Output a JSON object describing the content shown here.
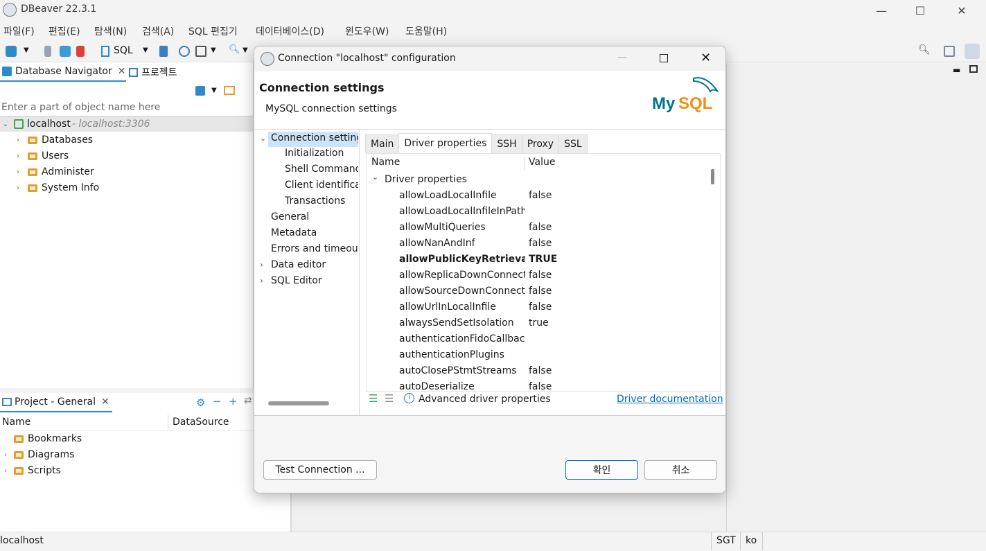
{
  "app": {
    "title": "DBeaver 22.3.1"
  },
  "menu": [
    "파일(F)",
    "편집(E)",
    "탐색(N)",
    "검색(A)",
    "SQL 편집기",
    "데이터베이스(D)",
    "윈도우(W)",
    "도움말(H)"
  ],
  "toolbar": {
    "sql_label": "SQL"
  },
  "navigator": {
    "tab_label": "Database Navigator",
    "tab2_label": "프로젝트",
    "filter_placeholder": "Enter a part of object name here",
    "connection": {
      "name": "localhost",
      "host": " - localhost:3306"
    },
    "items": [
      "Databases",
      "Users",
      "Administer",
      "System Info"
    ]
  },
  "project": {
    "tab_label": "Project - General",
    "col_name": "Name",
    "col_datasource": "DataSource",
    "items": [
      "Bookmarks",
      "Diagrams",
      "Scripts"
    ]
  },
  "status": {
    "left": "localhost",
    "tz": "SGT",
    "locale": "ko"
  },
  "dialog": {
    "title": "Connection \"localhost\" configuration",
    "heading": "Connection settings",
    "subheading": "MySQL connection settings",
    "logo_text": "MySQL",
    "nav": {
      "main": "Connection settings",
      "children": [
        "Initialization",
        "Shell Commands",
        "Client identification",
        "Transactions"
      ],
      "others": [
        "General",
        "Metadata",
        "Errors and timeouts"
      ],
      "expandable": [
        "Data editor",
        "SQL Editor"
      ]
    },
    "tabs": [
      "Main",
      "Driver properties",
      "SSH",
      "Proxy",
      "SSL"
    ],
    "grid": {
      "col_name": "Name",
      "col_value": "Value",
      "group": "Driver properties",
      "rows": [
        {
          "name": "allowLoadLocalInfile",
          "value": "false"
        },
        {
          "name": "allowLoadLocalInfileInPath",
          "value": ""
        },
        {
          "name": "allowMultiQueries",
          "value": "false"
        },
        {
          "name": "allowNanAndInf",
          "value": "false"
        },
        {
          "name": "allowPublicKeyRetrieval",
          "value": "TRUE"
        },
        {
          "name": "allowReplicaDownConnections",
          "value": "false"
        },
        {
          "name": "allowSourceDownConnections",
          "value": "false"
        },
        {
          "name": "allowUrlInLocalInfile",
          "value": "false"
        },
        {
          "name": "alwaysSendSetIsolation",
          "value": "true"
        },
        {
          "name": "authenticationFidoCallbackHandler",
          "value": ""
        },
        {
          "name": "authenticationPlugins",
          "value": ""
        },
        {
          "name": "autoClosePStmtStreams",
          "value": "false"
        },
        {
          "name": "autoDeserialize",
          "value": "false"
        }
      ]
    },
    "advanced_label": "Advanced driver properties",
    "doc_link": "Driver documentation",
    "test_button": "Test Connection ...",
    "ok_button": "확인",
    "cancel_button": "취소"
  },
  "colors": {
    "accent": "#0067c0",
    "selection": "#cce4f7",
    "mysql_blue": "#00758f",
    "mysql_orange": "#f29111"
  }
}
